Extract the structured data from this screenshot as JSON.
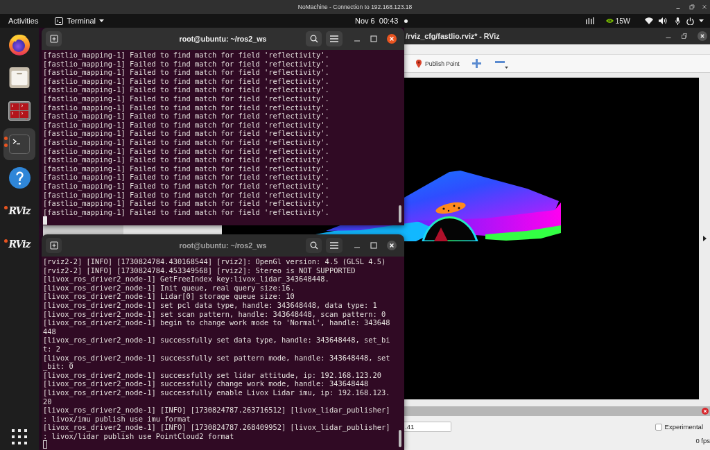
{
  "remote_session": {
    "title": "NoMachine - Connection to 192.168.123.18"
  },
  "top_bar": {
    "activities": "Activities",
    "app_menu": "Terminal",
    "clock": "Nov 6  00:43",
    "notification": true,
    "power": "15W"
  },
  "dock": {
    "items": [
      {
        "kind": "browser",
        "selected": false,
        "running": false
      },
      {
        "kind": "files",
        "selected": false,
        "running": false
      },
      {
        "kind": "multi_terminal",
        "selected": false,
        "running": false
      },
      {
        "kind": "terminal",
        "selected": true,
        "running": true,
        "multi_window": true
      },
      {
        "kind": "help",
        "selected": false,
        "running": false
      },
      {
        "kind": "rviz",
        "label": "RViz",
        "selected": false,
        "running": true,
        "multi_window": false
      },
      {
        "kind": "rviz",
        "label": "RViz",
        "selected": false,
        "running": true,
        "multi_window": false
      }
    ]
  },
  "rviz_window": {
    "title": "/rviz_cfg/fastlio.rviz* - RViz",
    "toolbar": [
      {
        "kind": "publish_point",
        "label": "Publish Point"
      },
      {
        "kind": "add"
      },
      {
        "kind": "remove"
      }
    ],
    "time_panel": {
      "time_value": ".41",
      "experimental": {
        "label": "Experimental",
        "checked": false
      },
      "fps": "0 fps"
    }
  },
  "terminals": [
    {
      "title": "root@ubuntu: ~/ros2_ws",
      "focused": true,
      "lines": [
        "[fastlio_mapping-1] Failed to find match for field 'reflectivity'.",
        "[fastlio_mapping-1] Failed to find match for field 'reflectivity'.",
        "[fastlio_mapping-1] Failed to find match for field 'reflectivity'.",
        "[fastlio_mapping-1] Failed to find match for field 'reflectivity'.",
        "[fastlio_mapping-1] Failed to find match for field 'reflectivity'.",
        "[fastlio_mapping-1] Failed to find match for field 'reflectivity'.",
        "[fastlio_mapping-1] Failed to find match for field 'reflectivity'.",
        "[fastlio_mapping-1] Failed to find match for field 'reflectivity'.",
        "[fastlio_mapping-1] Failed to find match for field 'reflectivity'.",
        "[fastlio_mapping-1] Failed to find match for field 'reflectivity'.",
        "[fastlio_mapping-1] Failed to find match for field 'reflectivity'.",
        "[fastlio_mapping-1] Failed to find match for field 'reflectivity'.",
        "[fastlio_mapping-1] Failed to find match for field 'reflectivity'.",
        "[fastlio_mapping-1] Failed to find match for field 'reflectivity'.",
        "[fastlio_mapping-1] Failed to find match for field 'reflectivity'.",
        "[fastlio_mapping-1] Failed to find match for field 'reflectivity'.",
        "[fastlio_mapping-1] Failed to find match for field 'reflectivity'.",
        "[fastlio_mapping-1] Failed to find match for field 'reflectivity'.",
        "[fastlio_mapping-1] Failed to find match for field 'reflectivity'."
      ]
    },
    {
      "title": "root@ubuntu: ~/ros2_ws",
      "focused": false,
      "lines": [
        "[rviz2-2] [INFO] [1730824784.430168544] [rviz2]: OpenGl version: 4.5 (GLSL 4.5)",
        "[rviz2-2] [INFO] [1730824784.453349568] [rviz2]: Stereo is NOT SUPPORTED",
        "[livox_ros_driver2_node-1] GetFreeIndex key:livox_lidar_343648448.",
        "[livox_ros_driver2_node-1] Init queue, real query size:16.",
        "[livox_ros_driver2_node-1] Lidar[0] storage queue size: 10",
        "[livox_ros_driver2_node-1] set pcl data type, handle: 343648448, data type: 1",
        "[livox_ros_driver2_node-1] set scan pattern, handle: 343648448, scan pattern: 0",
        "[livox_ros_driver2_node-1] begin to change work mode to 'Normal', handle: 343648448",
        "[livox_ros_driver2_node-1] successfully set data type, handle: 343648448, set_bit: 2",
        "[livox_ros_driver2_node-1] successfully set pattern mode, handle: 343648448, set_bit: 0",
        "[livox_ros_driver2_node-1] successfully set lidar attitude, ip: 192.168.123.20",
        "[livox_ros_driver2_node-1] successfully change work mode, handle: 343648448",
        "[livox_ros_driver2_node-1] successfully enable Livox Lidar imu, ip: 192.168.123.20",
        "[livox_ros_driver2_node-1] [INFO] [1730824787.263716512] [livox_lidar_publisher]: livox/imu publish use imu format",
        "[livox_ros_driver2_node-1] [INFO] [1730824787.268409952] [livox_lidar_publisher]: livox/lidar publish use PointCloud2 format"
      ]
    }
  ]
}
